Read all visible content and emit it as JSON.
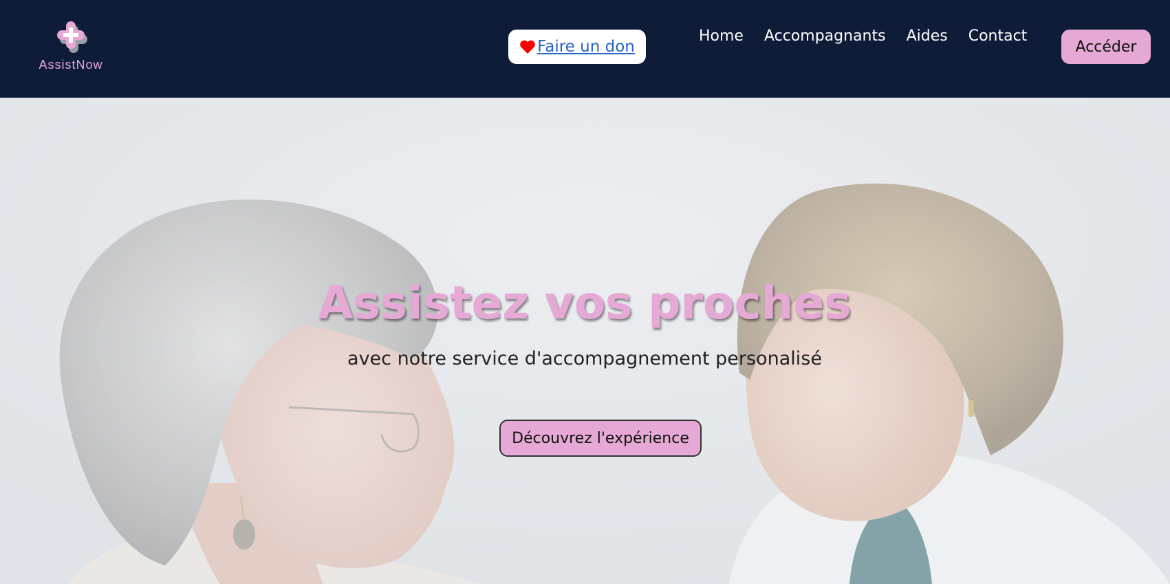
{
  "brand": {
    "name": "AssistNow",
    "color": "#e6a8d5",
    "logo_icon": "medical-cross-icon"
  },
  "navbar": {
    "background": "#0f1c38",
    "donate": {
      "label": "Faire un don",
      "icon": "heart-icon",
      "icon_color": "#ff0000"
    },
    "links": [
      {
        "label": "Home"
      },
      {
        "label": "Accompagnants"
      },
      {
        "label": "Aides"
      },
      {
        "label": "Contact"
      }
    ],
    "access_label": "Accéder"
  },
  "hero": {
    "title": "Assistez vos proches",
    "subtitle": "avec notre service d'accompagnement personalisé",
    "cta_label": "Découvrez l'expérience"
  }
}
